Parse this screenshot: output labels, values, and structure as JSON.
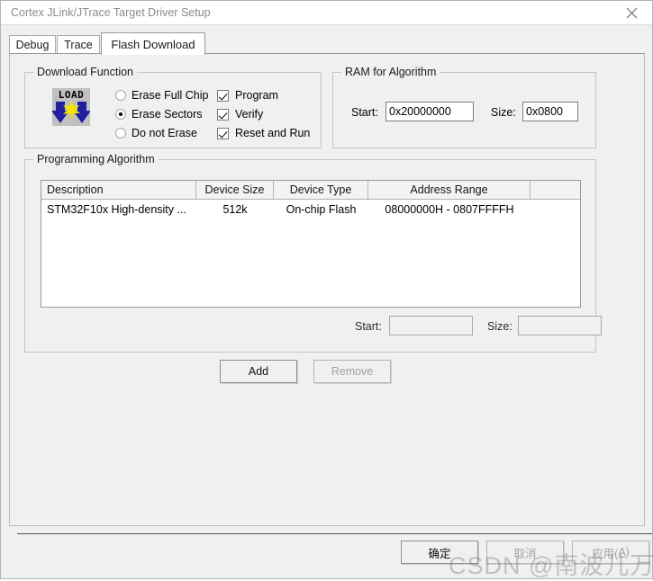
{
  "window": {
    "title": "Cortex JLink/JTrace Target Driver Setup",
    "close_icon": "close-icon"
  },
  "tabs": [
    {
      "id": "debug",
      "label": "Debug",
      "active": false
    },
    {
      "id": "trace",
      "label": "Trace",
      "active": false
    },
    {
      "id": "flash",
      "label": "Flash Download",
      "active": true
    }
  ],
  "download_function": {
    "title": "Download Function",
    "icon": "load-icon",
    "icon_text": "LOAD",
    "erase_mode_selected": "Erase Sectors",
    "radios": [
      {
        "label": "Erase Full Chip",
        "checked": false
      },
      {
        "label": "Erase Sectors",
        "checked": true
      },
      {
        "label": "Do not Erase",
        "checked": false
      }
    ],
    "checkboxes": [
      {
        "label": "Program",
        "checked": true
      },
      {
        "label": "Verify",
        "checked": true
      },
      {
        "label": "Reset and Run",
        "checked": true
      }
    ]
  },
  "ram_for_algorithm": {
    "title": "RAM for Algorithm",
    "start_label": "Start:",
    "start_value": "0x20000000",
    "size_label": "Size:",
    "size_value": "0x0800"
  },
  "programming_algorithm": {
    "title": "Programming Algorithm",
    "columns": [
      "Description",
      "Device Size",
      "Device Type",
      "Address Range",
      ""
    ],
    "rows": [
      {
        "description": "STM32F10x High-density ...",
        "device_size": "512k",
        "device_type": "On-chip Flash",
        "address_range": "08000000H - 0807FFFFH",
        "extra": ""
      }
    ],
    "start_label": "Start:",
    "start_value": "",
    "size_label": "Size:",
    "size_value": "",
    "add_button": "Add",
    "remove_button": "Remove"
  },
  "dialog_buttons": {
    "ok": "确定",
    "cancel": "取消",
    "apply_prefix": "应用(",
    "apply_accel": "A",
    "apply_suffix": ")"
  },
  "watermark": {
    "text": "CSDN @南波儿万"
  },
  "colors": {
    "dialog_background": "#f0f0f0",
    "titlebar_background": "#ffffff",
    "title_text": "#8b8b8b",
    "field_background": "#ffffff",
    "group_border": "#c4c4c4",
    "icon_blue": "#1f1fa0",
    "icon_yellow": "#f2e400",
    "icon_grey": "#c0c0c0",
    "disabled_text": "#a2a2a2"
  }
}
